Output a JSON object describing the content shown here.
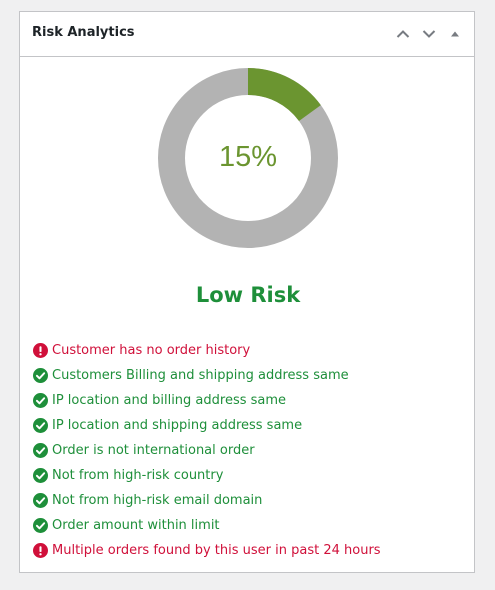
{
  "widget": {
    "title": "Risk Analytics",
    "controls": [
      "move-up",
      "move-down",
      "toggle-panel"
    ]
  },
  "score": {
    "value_percent": 15,
    "display": "15%",
    "fill_color": "#6b9530",
    "track_color": "#b3b3b3",
    "label": "Low Risk",
    "label_color": "#1e8f3a"
  },
  "checks": [
    {
      "status": "fail",
      "text": "Customer has no order history"
    },
    {
      "status": "pass",
      "text": "Customers Billing and shipping address same"
    },
    {
      "status": "pass",
      "text": "IP location and billing address same"
    },
    {
      "status": "pass",
      "text": "IP location and shipping address same"
    },
    {
      "status": "pass",
      "text": "Order is not international order"
    },
    {
      "status": "pass",
      "text": "Not from high-risk country"
    },
    {
      "status": "pass",
      "text": "Not from high-risk email domain"
    },
    {
      "status": "pass",
      "text": "Order amount within limit"
    },
    {
      "status": "fail",
      "text": "Multiple orders found by this user in past 24 hours"
    }
  ],
  "colors": {
    "pass": "#1e8f3a",
    "fail": "#d0103a"
  }
}
